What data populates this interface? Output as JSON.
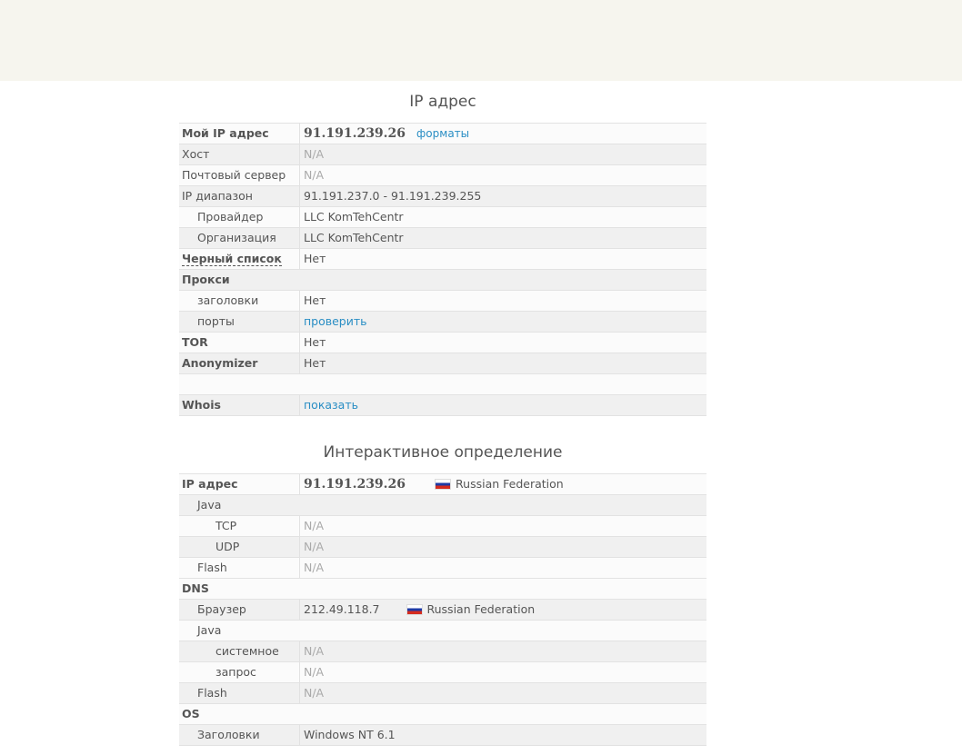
{
  "ip_section": {
    "title": "IP адрес",
    "my_ip_label": "Мой IP адрес",
    "my_ip_value": "91.191.239.26",
    "formats_link": "форматы",
    "host_label": "Хост",
    "host_value": "N/A",
    "mail_label": "Почтовый сервер",
    "mail_value": "N/A",
    "range_label": "IP диапазон",
    "range_value": "91.191.237.0 - 91.191.239.255",
    "provider_label": "Провайдер",
    "provider_value": "LLC KomTehCentr",
    "org_label": "Организация",
    "org_value": "LLC KomTehCentr",
    "blacklist_label": "Черный список",
    "blacklist_value": "Нет",
    "proxy_label": "Прокси",
    "headers_label": "заголовки",
    "headers_value": "Нет",
    "ports_label": "порты",
    "ports_link": "проверить",
    "tor_label": "TOR",
    "tor_value": "Нет",
    "anon_label": "Anonymizer",
    "anon_value": "Нет",
    "whois_label": "Whois",
    "whois_link": "показать"
  },
  "interactive_section": {
    "title": "Интерактивное определение",
    "ip_label": "IP адрес",
    "ip_value": "91.191.239.26",
    "ip_country": "Russian Federation",
    "java_label": "Java",
    "tcp_label": "TCP",
    "tcp_value": "N/A",
    "udp_label": "UDP",
    "udp_value": "N/A",
    "flash_label": "Flash",
    "flash_value": "N/A",
    "dns_label": "DNS",
    "browser_label": "Браузер",
    "browser_value": "212.49.118.7",
    "browser_country": "Russian Federation",
    "dns_java_label": "Java",
    "system_label": "системное",
    "system_value": "N/A",
    "request_label": "запрос",
    "request_value": "N/A",
    "dns_flash_label": "Flash",
    "dns_flash_value": "N/A",
    "os_label": "OS",
    "os_headers_label": "Заголовки",
    "os_headers_value": "Windows NT 6.1"
  }
}
